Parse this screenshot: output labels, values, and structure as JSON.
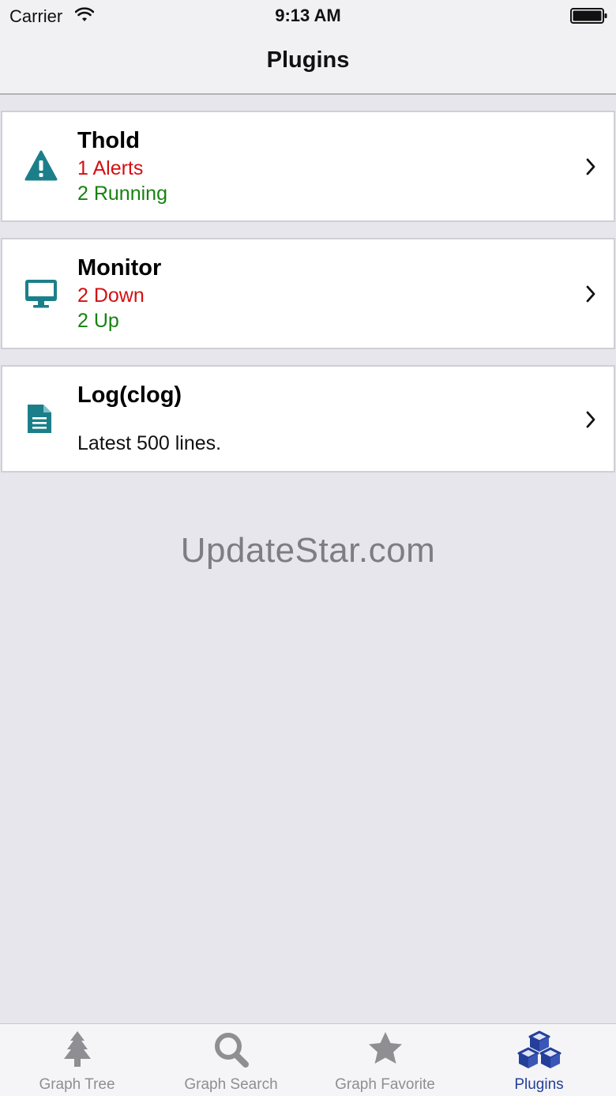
{
  "status_bar": {
    "carrier": "Carrier",
    "time": "9:13 AM"
  },
  "nav": {
    "title": "Plugins"
  },
  "plugins": [
    {
      "title": "Thold",
      "line1": "1 Alerts",
      "line2": "2 Running",
      "icon": "warning-icon"
    },
    {
      "title": "Monitor",
      "line1": "2 Down",
      "line2": "2 Up",
      "icon": "monitor-icon"
    },
    {
      "title": "Log(clog)",
      "line1": "Latest 500 lines.",
      "icon": "document-icon"
    }
  ],
  "watermark": "UpdateStar.com",
  "tabs": [
    {
      "label": "Graph Tree",
      "icon": "tree-icon"
    },
    {
      "label": "Graph Search",
      "icon": "search-icon"
    },
    {
      "label": "Graph Favorite",
      "icon": "star-icon"
    },
    {
      "label": "Plugins",
      "icon": "cubes-icon",
      "active": true
    }
  ],
  "colors": {
    "accent": "#243f9a",
    "icon_teal": "#1b7f8a",
    "alert_red": "#d40f13",
    "ok_green": "#16820f"
  }
}
